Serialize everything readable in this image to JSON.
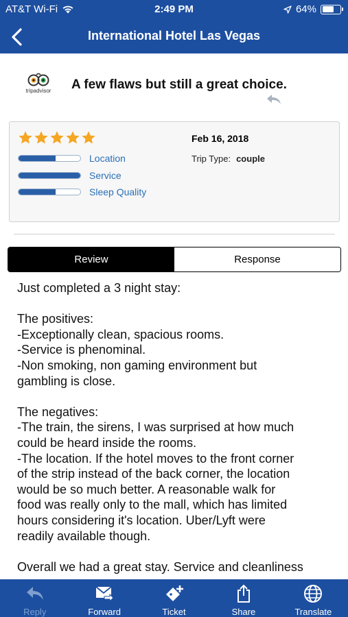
{
  "status": {
    "carrier": "AT&T Wi-Fi",
    "time": "2:49 PM",
    "battery": "64%",
    "battery_level": 0.64
  },
  "nav": {
    "title": "International Hotel Las Vegas"
  },
  "review": {
    "source_logo_text": "tripadvisor",
    "headline": "A few flaws but still a great choice.",
    "stars": 5,
    "date": "Feb 16, 2018",
    "trip_type_label": "Trip Type:",
    "trip_type_value": "couple",
    "ratings": [
      {
        "label": "Location",
        "score": 3
      },
      {
        "label": "Service",
        "score": 5
      },
      {
        "label": "Sleep Quality",
        "score": 3
      }
    ],
    "ratings_max": 5
  },
  "tabs": {
    "review": "Review",
    "response": "Response"
  },
  "body": {
    "lines": [
      "Just completed a 3 night stay:",
      "",
      "The positives:",
      "-Exceptionally clean, spacious rooms.",
      "-Service is phenominal.",
      "-Non smoking, non gaming environment but",
      "gambling is close.",
      "",
      "The negatives:",
      "-The train, the sirens, I was surprised at how much",
      "could be heard inside the rooms.",
      "-The location. If the hotel moves to the front corner",
      "of the strip instead of the back corner, the location",
      "would be so much better. A reasonable walk for",
      "food was really only to the mall, which has limited",
      "hours considering it's location. Uber/Lyft were",
      "readily available though.",
      "",
      "Overall we had a great stay. Service and cleanliness"
    ]
  },
  "toolbar": {
    "reply": "Reply",
    "forward": "Forward",
    "ticket": "Ticket",
    "share": "Share",
    "translate": "Translate"
  },
  "colors": {
    "brand_blue": "#1d4fa0",
    "bar_fill": "#2a5fa8",
    "link_blue": "#2a6fb8",
    "star_gold": "#f5a623"
  }
}
